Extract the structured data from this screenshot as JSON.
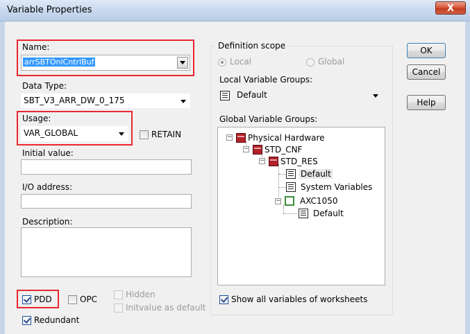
{
  "window": {
    "title": "Variable Properties",
    "close_glyph": "X"
  },
  "left": {
    "name_label": "Name:",
    "name_value": "arrSBTOnlCntrlBuf",
    "data_type_label": "Data Type:",
    "data_type_value": "SBT_V3_ARR_DW_0_175",
    "usage_label": "Usage:",
    "usage_value": "VAR_GLOBAL",
    "retain_label": "RETAIN",
    "initial_value_label": "Initial value:",
    "initial_value": "",
    "io_address_label": "I/O address:",
    "io_address": "",
    "description_label": "Description:",
    "description": "",
    "pdd_label": "PDD",
    "opc_label": "OPC",
    "hidden_label": "Hidden",
    "initvalue_default_label": "Initvalue as default",
    "redundant_label": "Redundant"
  },
  "middle": {
    "scope_group_label": "Definition scope",
    "local_label": "Local",
    "global_label": "Global",
    "local_groups_label": "Local Variable Groups:",
    "local_groups_value": "Default",
    "global_groups_label": "Global Variable Groups:",
    "tree": {
      "physical_hardware": "Physical Hardware",
      "std_cnf": "STD_CNF",
      "std_res": "STD_RES",
      "default_1": "Default",
      "system_variables": "System Variables",
      "axc1050": "AXC1050",
      "default_2": "Default"
    },
    "show_all_label": "Show all variables of worksheets"
  },
  "buttons": {
    "ok": "OK",
    "cancel": "Cancel",
    "help": "Help"
  },
  "colors": {
    "highlight_border": "#e8272f",
    "selection": "#3399ff"
  }
}
